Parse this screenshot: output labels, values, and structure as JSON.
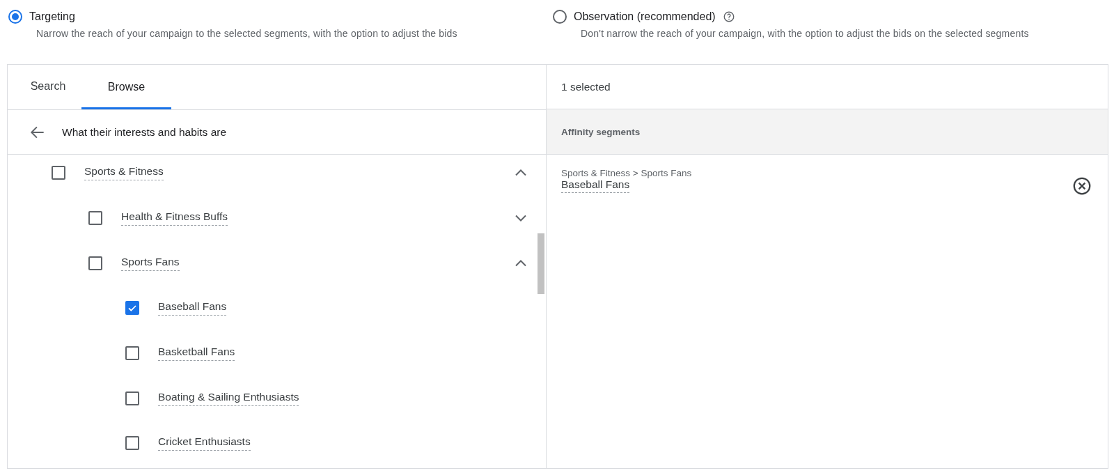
{
  "modes": [
    {
      "label": "Targeting",
      "description": "Narrow the reach of your campaign to the selected segments, with the option to adjust the bids",
      "selected": true,
      "help": false
    },
    {
      "label": "Observation (recommended)",
      "description": "Don't narrow the reach of your campaign, with the option to adjust the bids on the selected segments",
      "selected": false,
      "help": true
    }
  ],
  "tabs": [
    {
      "label": "Search",
      "selected": false
    },
    {
      "label": "Browse",
      "selected": true
    }
  ],
  "breadcrumb": "What their interests and habits are",
  "tree": [
    {
      "label": "Sports & Fitness",
      "checked": false,
      "expanded": true,
      "children": [
        {
          "label": "Health & Fitness Buffs",
          "checked": false,
          "expanded": false
        },
        {
          "label": "Sports Fans",
          "checked": false,
          "expanded": true,
          "children": [
            {
              "label": "Baseball Fans",
              "checked": true
            },
            {
              "label": "Basketball Fans",
              "checked": false
            },
            {
              "label": "Boating & Sailing Enthusiasts",
              "checked": false
            },
            {
              "label": "Cricket Enthusiasts",
              "checked": false
            }
          ]
        }
      ]
    }
  ],
  "selection": {
    "count": "1 selected",
    "group": "Affinity segments",
    "items": [
      {
        "path": "Sports & Fitness > Sports Fans",
        "name": "Baseball Fans"
      }
    ]
  }
}
